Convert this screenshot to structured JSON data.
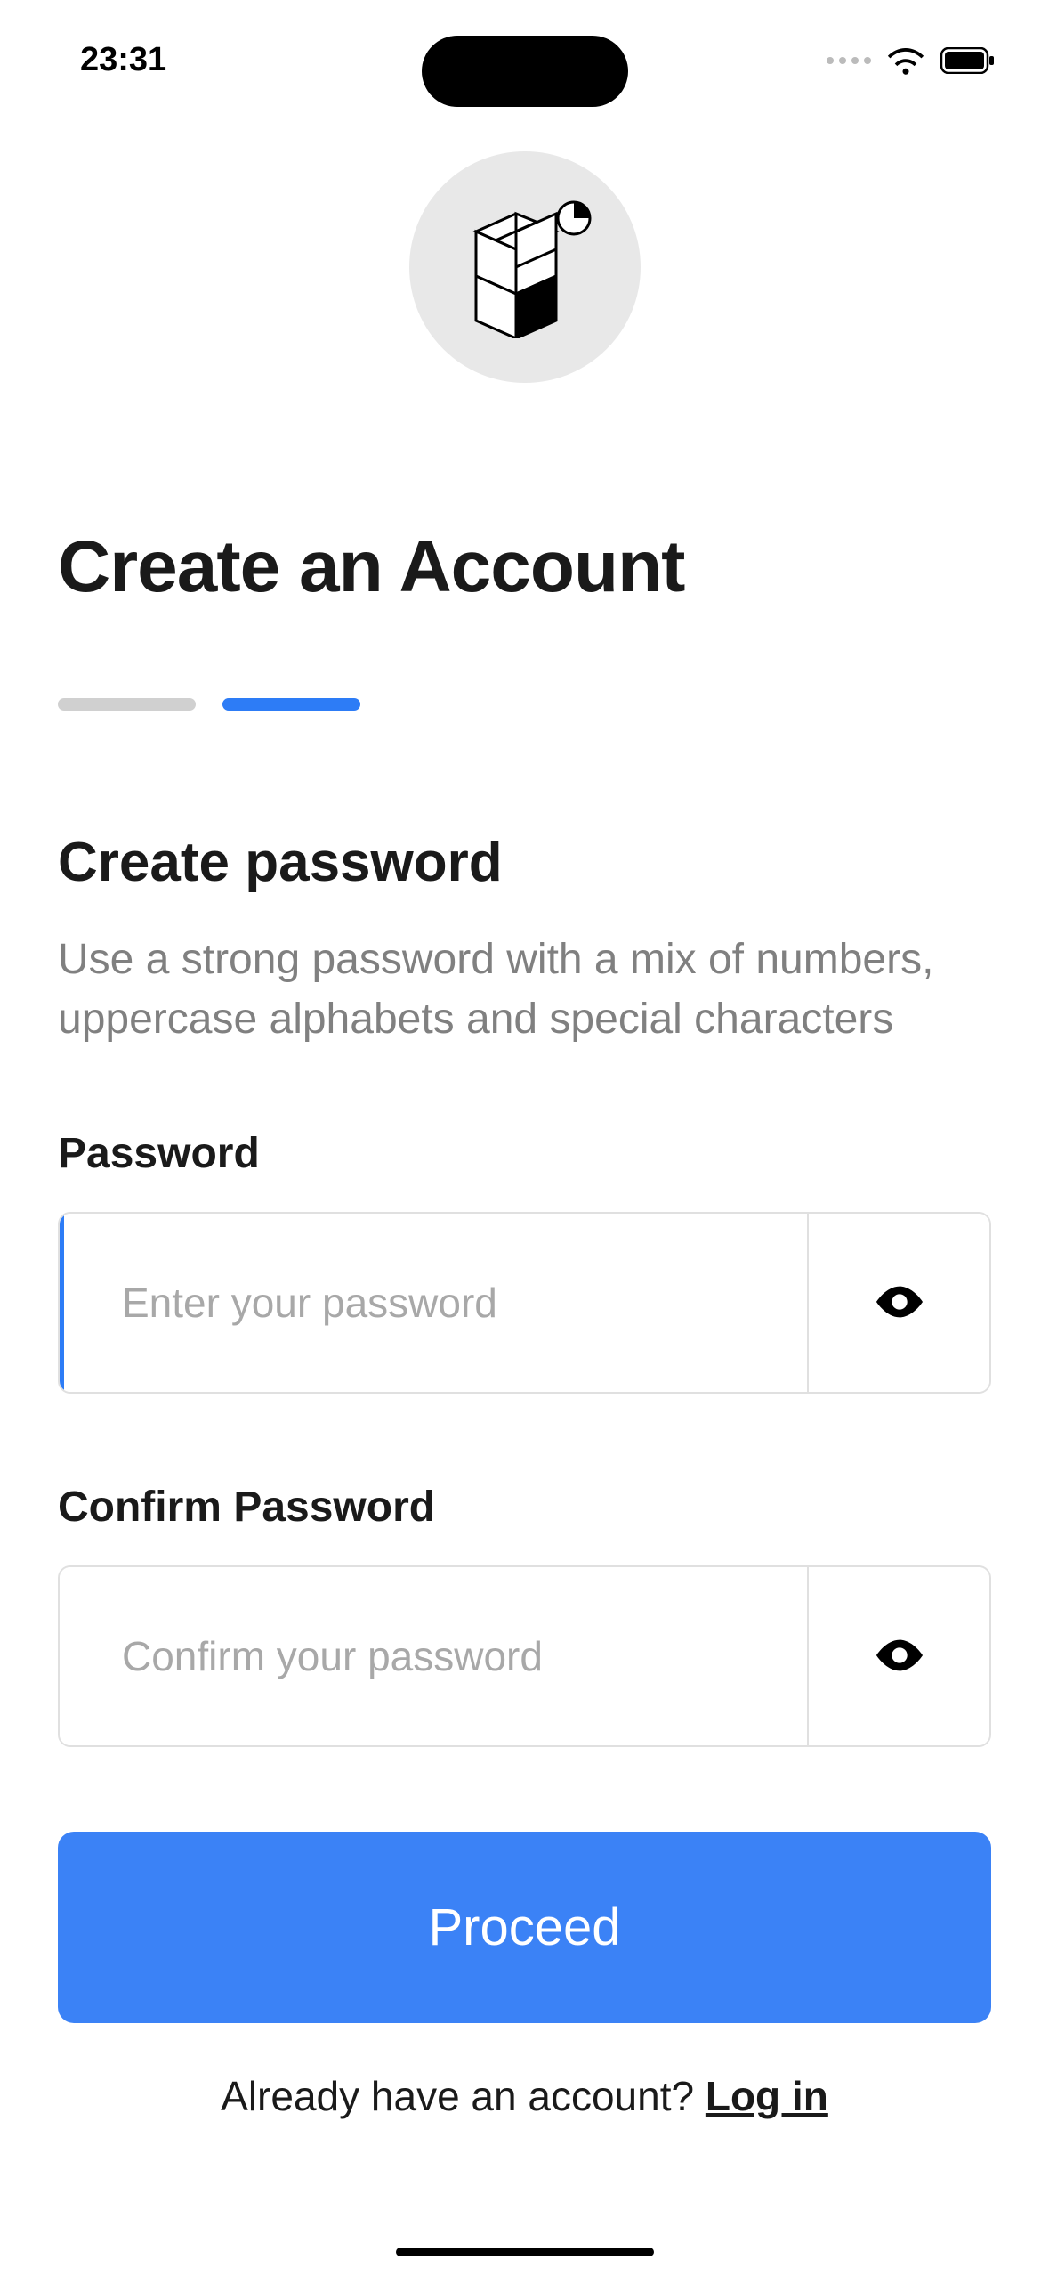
{
  "status_bar": {
    "time": "23:31"
  },
  "header": {
    "title": "Create an Account"
  },
  "section": {
    "title": "Create password",
    "description": "Use a strong password with a mix of numbers, uppercase alphabets and special characters"
  },
  "fields": {
    "password": {
      "label": "Password",
      "placeholder": "Enter your password",
      "value": ""
    },
    "confirm_password": {
      "label": "Confirm Password",
      "placeholder": "Confirm your password",
      "value": ""
    }
  },
  "actions": {
    "proceed_label": "Proceed"
  },
  "footer": {
    "prompt": "Already have an account? ",
    "login_link": "Log in"
  }
}
